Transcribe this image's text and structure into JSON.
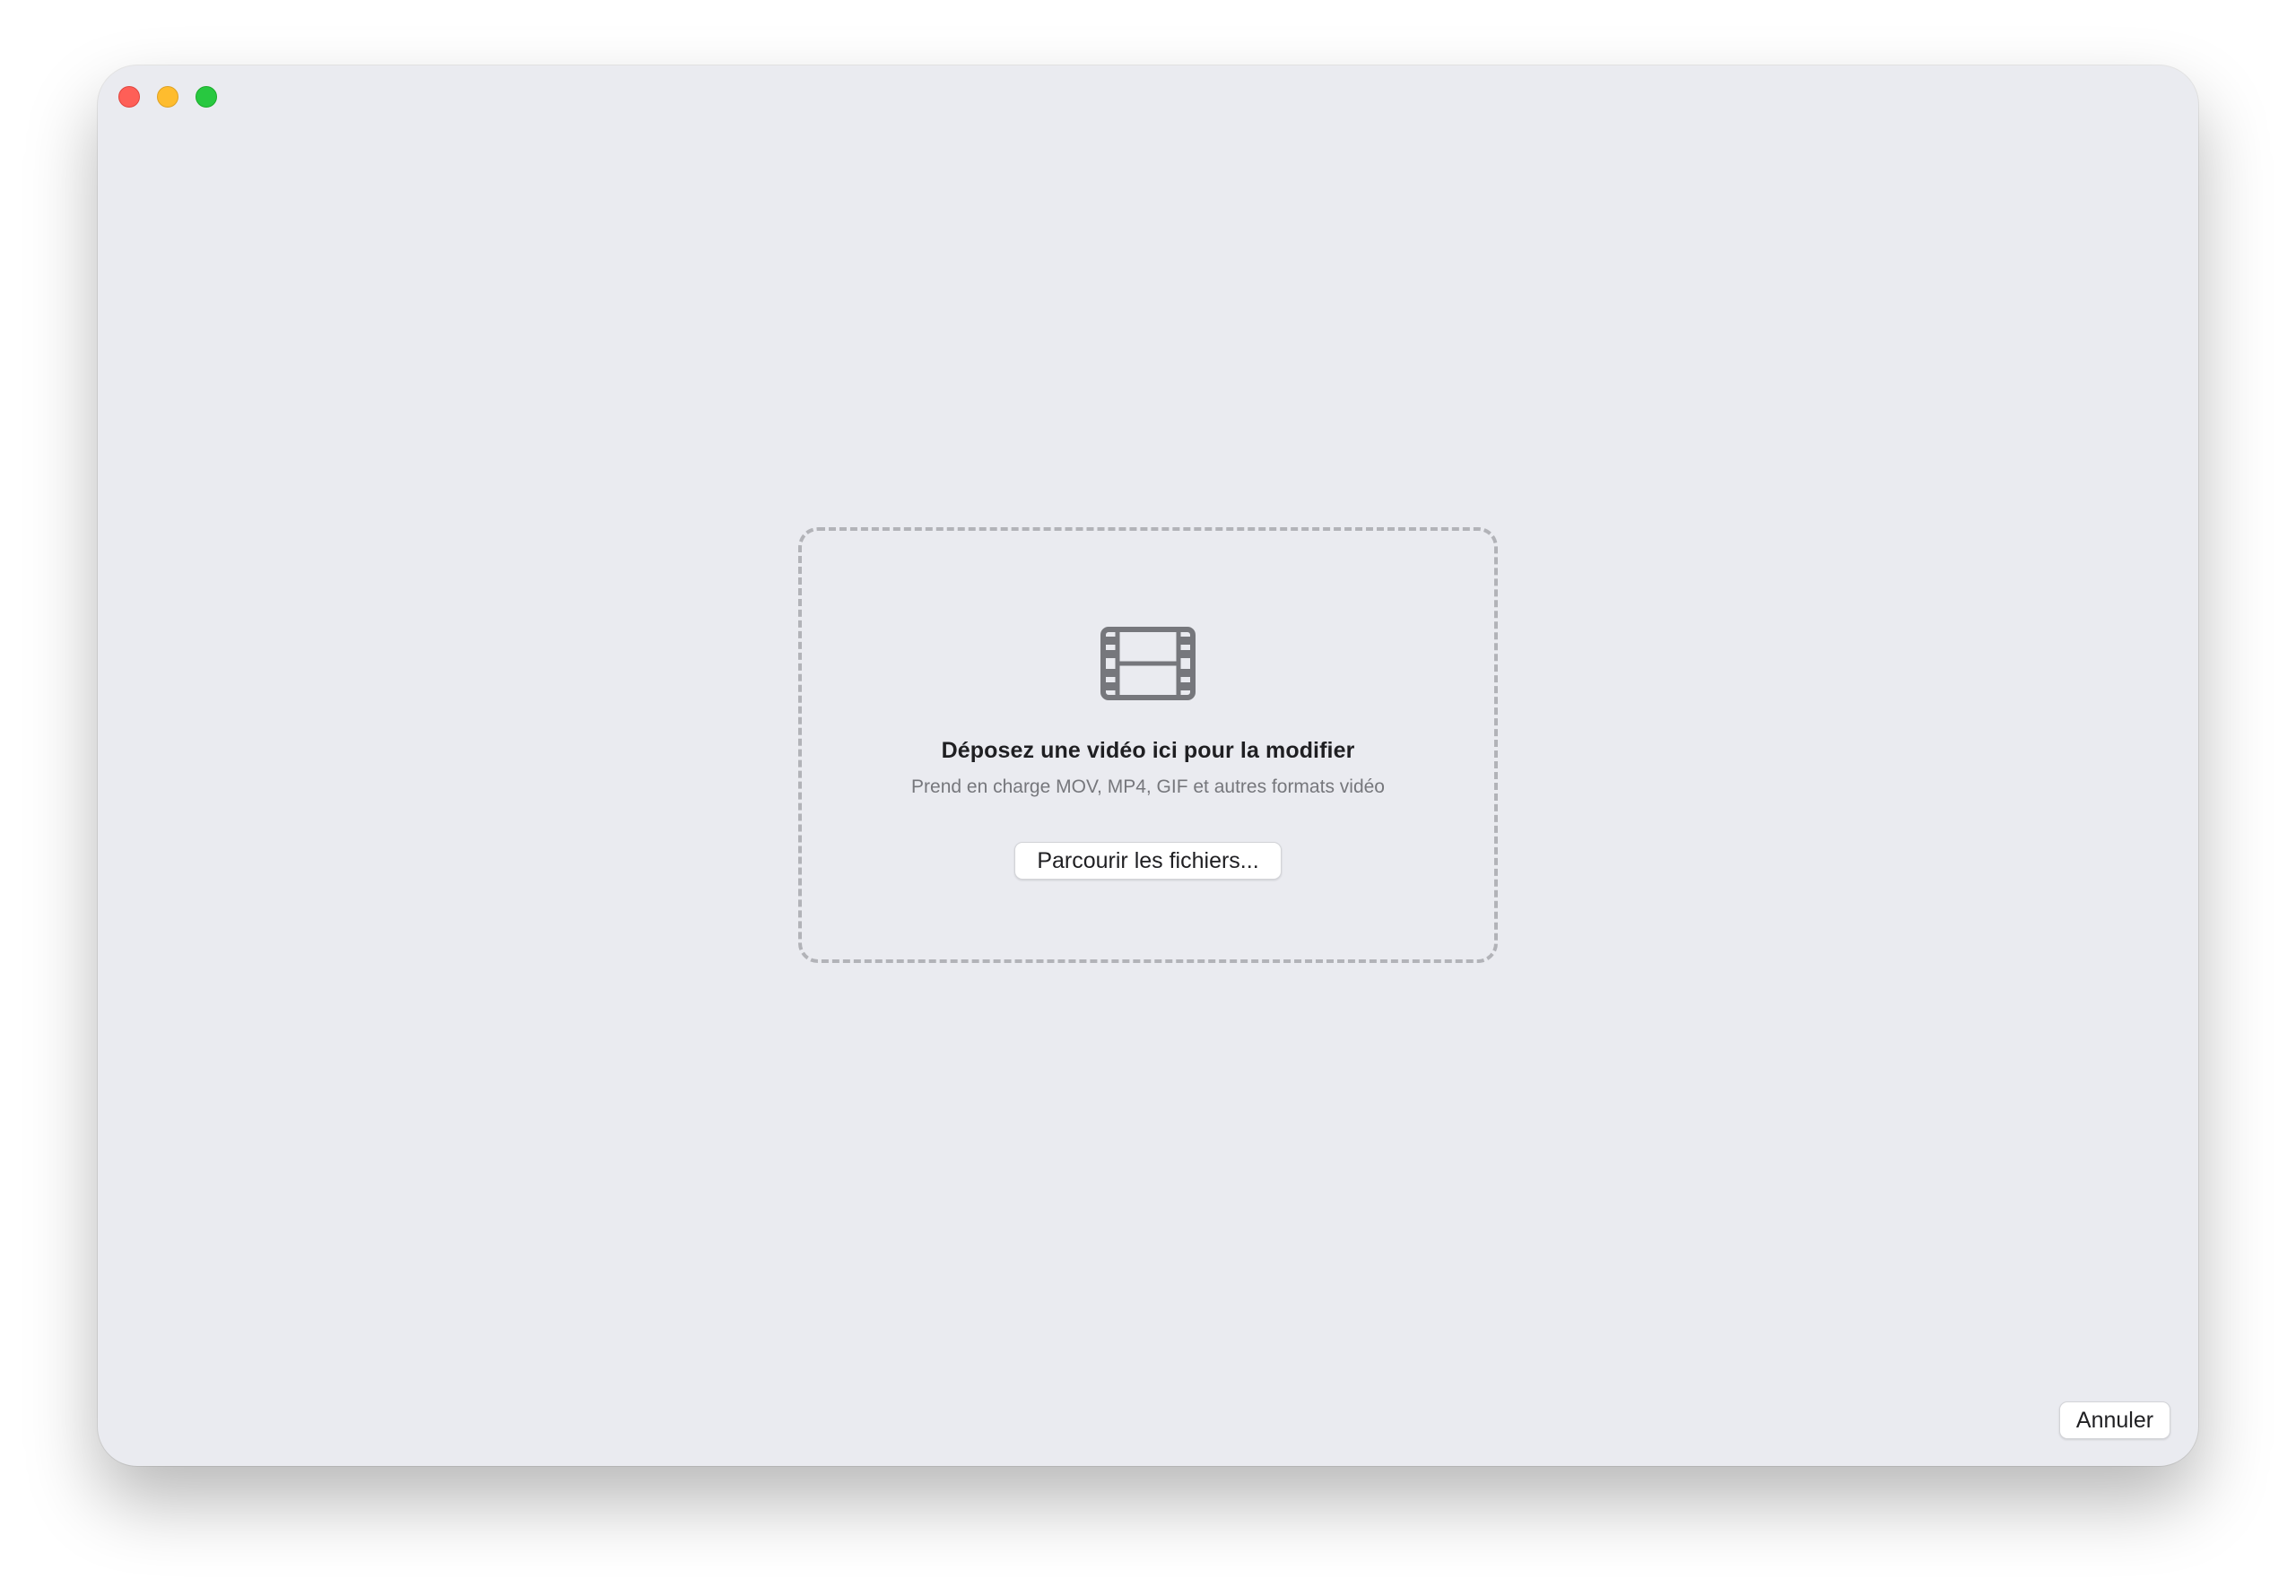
{
  "window": {
    "controls": {
      "close": "close-button",
      "minimize": "minimize-button",
      "zoom": "zoom-button"
    },
    "colors": {
      "background": "#eaebf0",
      "close": "#fe5f57",
      "minimize": "#febc2e",
      "zoom": "#28c840"
    }
  },
  "dropzone": {
    "icon": "film-icon",
    "title": "Déposez une vidéo ici pour la modifier",
    "subtitle": "Prend en charge MOV, MP4, GIF et autres formats vidéo",
    "browse_label": "Parcourir les fichiers..."
  },
  "footer": {
    "cancel_label": "Annuler"
  }
}
